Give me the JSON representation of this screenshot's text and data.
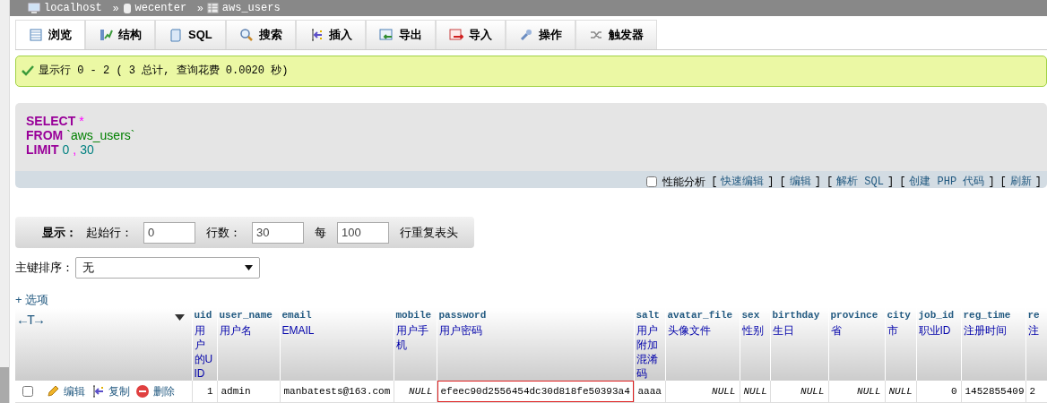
{
  "breadcrumb": [
    {
      "kind": "server",
      "label": "localhost"
    },
    {
      "kind": "database",
      "prefix": "»",
      "label": "wecenter"
    },
    {
      "kind": "table",
      "prefix": "»",
      "label": "aws_users"
    }
  ],
  "tabs": [
    {
      "kind": "browse",
      "label": "浏览",
      "selected": true
    },
    {
      "kind": "structure",
      "label": "结构",
      "selected": false
    },
    {
      "kind": "sql",
      "label": "SQL",
      "selected": false
    },
    {
      "kind": "search",
      "label": "搜索",
      "selected": false
    },
    {
      "kind": "insert",
      "label": "插入",
      "selected": false
    },
    {
      "kind": "export",
      "label": "导出",
      "selected": false
    },
    {
      "kind": "import",
      "label": "导入",
      "selected": false
    },
    {
      "kind": "operations",
      "label": "操作",
      "selected": false
    },
    {
      "kind": "triggers",
      "label": "触发器",
      "selected": false
    }
  ],
  "message": "显示行 0 - 2 ( 3 总计, 查询花费 0.0020 秒)",
  "sql": [
    [
      {
        "kind": "keyword",
        "text": "SELECT"
      },
      {
        "kind": "operator",
        "text": "*"
      }
    ],
    [
      {
        "kind": "keyword",
        "text": "FROM"
      },
      {
        "kind": "identifier",
        "text": "`aws_users`"
      }
    ],
    [
      {
        "kind": "keyword",
        "text": "LIMIT"
      },
      {
        "kind": "number",
        "text": "0"
      },
      {
        "kind": "operator",
        "text": ","
      },
      {
        "kind": "number",
        "text": "30"
      }
    ]
  ],
  "sql_actions": {
    "profiling": {
      "label": "性能分析",
      "checked": false
    },
    "links": [
      {
        "open": "[",
        "text": "快速编辑",
        "close": "]"
      },
      {
        "open": "[",
        "text": "编辑",
        "close": "]"
      },
      {
        "open": "[",
        "text": "解析 SQL",
        "close": "]"
      },
      {
        "open": "[",
        "text": "创建 PHP 代码",
        "close": "]"
      },
      {
        "open": "[",
        "text": "刷新",
        "close": "]"
      }
    ]
  },
  "display": {
    "title": "显示：",
    "fields": [
      {
        "label": "起始行：",
        "value": "0"
      },
      {
        "label": "行数：",
        "value": "30"
      },
      {
        "label": "每",
        "value": "100"
      }
    ],
    "suffix": "行重复表头"
  },
  "sort": {
    "label": "主键排序：",
    "value": "无"
  },
  "options_link": "+ 选项",
  "table": {
    "arrows": "←T→",
    "columns": [
      {
        "name": "uid",
        "comment": "用户的UID"
      },
      {
        "name": "user_name",
        "comment": "用户名"
      },
      {
        "name": "email",
        "comment": "EMAIL"
      },
      {
        "name": "mobile",
        "comment": "用户手机"
      },
      {
        "name": "password",
        "comment": "用户密码"
      },
      {
        "name": "salt",
        "comment": "用户附加混淆码"
      },
      {
        "name": "avatar_file",
        "comment": "头像文件"
      },
      {
        "name": "sex",
        "comment": "性别"
      },
      {
        "name": "birthday",
        "comment": "生日"
      },
      {
        "name": "province",
        "comment": "省"
      },
      {
        "name": "city",
        "comment": "市"
      },
      {
        "name": "job_id",
        "comment": "职业ID"
      },
      {
        "name": "reg_time",
        "comment": "注册时间"
      },
      {
        "name": "re",
        "comment": "注"
      }
    ],
    "rows": [
      {
        "checked": false,
        "actions": [
          {
            "kind": "edit",
            "label": "编辑"
          },
          {
            "kind": "copy",
            "label": "复制"
          },
          {
            "kind": "delete",
            "label": "删除"
          }
        ],
        "cells": [
          {
            "kind": "number",
            "text": "1",
            "highlighted": false
          },
          {
            "kind": "text",
            "text": "admin",
            "highlighted": false
          },
          {
            "kind": "text",
            "text": "manbatests@163.com",
            "highlighted": false
          },
          {
            "kind": "null",
            "text": "NULL",
            "highlighted": false
          },
          {
            "kind": "text",
            "text": "efeec90d2556454dc30d818fe50393a4",
            "highlighted": true
          },
          {
            "kind": "text",
            "text": "aaaa",
            "highlighted": false
          },
          {
            "kind": "null",
            "text": "NULL",
            "highlighted": false
          },
          {
            "kind": "null",
            "text": "NULL",
            "highlighted": false
          },
          {
            "kind": "null",
            "text": "NULL",
            "highlighted": false
          },
          {
            "kind": "null",
            "text": "NULL",
            "highlighted": false
          },
          {
            "kind": "null",
            "text": "NULL",
            "highlighted": false
          },
          {
            "kind": "number",
            "text": "0",
            "highlighted": false
          },
          {
            "kind": "number",
            "text": "1452855409",
            "highlighted": false
          },
          {
            "kind": "text",
            "text": "2",
            "highlighted": false
          }
        ]
      }
    ]
  }
}
